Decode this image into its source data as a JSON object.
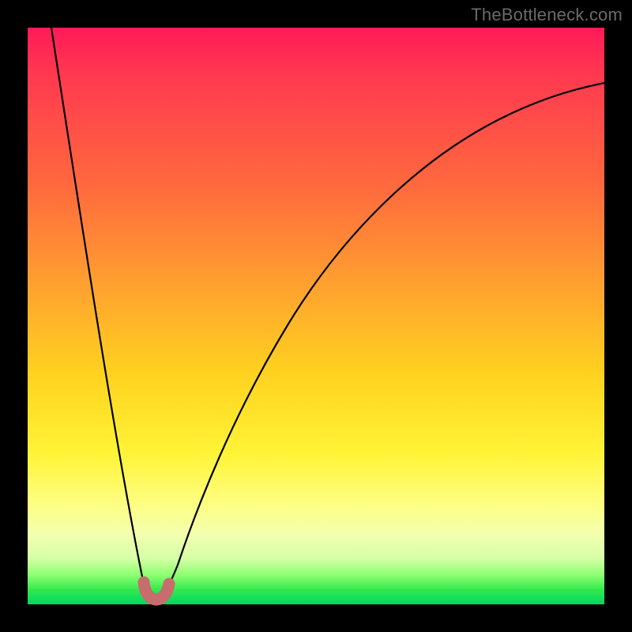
{
  "watermark": "TheBottleneck.com",
  "chart_data": {
    "type": "line",
    "title": "",
    "xlabel": "",
    "ylabel": "",
    "xlim": [
      0,
      100
    ],
    "ylim": [
      0,
      100
    ],
    "grid": false,
    "legend": false,
    "series": [
      {
        "name": "left-branch",
        "x": [
          4,
          6,
          8,
          10,
          12,
          14,
          16,
          18,
          19,
          20,
          21
        ],
        "values": [
          100,
          88,
          76,
          64,
          52,
          40,
          28,
          15,
          8,
          3,
          1
        ]
      },
      {
        "name": "right-branch",
        "x": [
          23,
          24,
          25,
          27,
          30,
          34,
          40,
          48,
          58,
          70,
          84,
          100
        ],
        "values": [
          1,
          3,
          8,
          18,
          32,
          46,
          59,
          69,
          77,
          83,
          87,
          90
        ]
      }
    ],
    "annotations": [
      {
        "name": "valley-marker",
        "shape": "u",
        "x_center": 22,
        "y_center": 1.5,
        "color": "#c76d6d"
      }
    ],
    "gradient_stops": [
      {
        "pct": 0,
        "color": "#ff1a57"
      },
      {
        "pct": 28,
        "color": "#ff6b3d"
      },
      {
        "pct": 60,
        "color": "#ffd21f"
      },
      {
        "pct": 83,
        "color": "#fdff86"
      },
      {
        "pct": 100,
        "color": "#00d860"
      }
    ]
  }
}
